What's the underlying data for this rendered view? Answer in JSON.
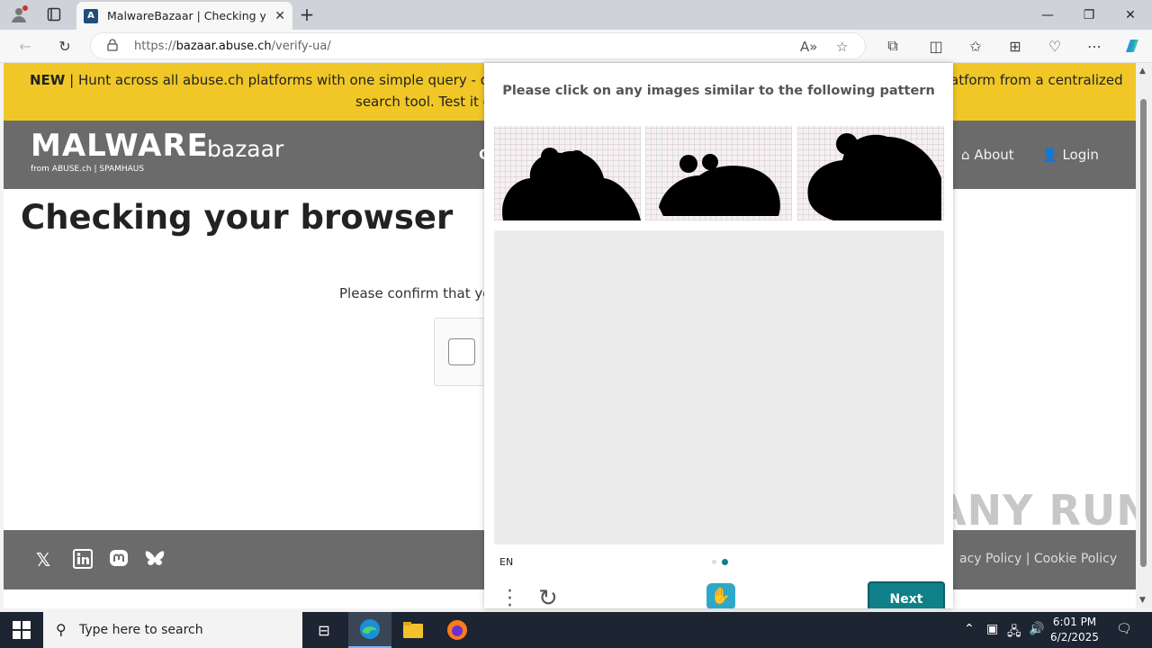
{
  "browser": {
    "tab_title": "MalwareBazaar | Checking your b",
    "tab_favicon_letter": "A",
    "url_prefix": "https://",
    "url_host": "bazaar.abuse.ch",
    "url_path": "/verify-ua/",
    "window_controls": [
      "minimize",
      "restore",
      "close"
    ]
  },
  "site": {
    "banner_new": "NEW",
    "banner_text": " | Hunt across all abuse.ch platforms with one simple query - discove",
    "banner_text_right": "atform from a centralized",
    "banner_text_line2": "search tool. Test it ou",
    "logo_main": "MALWARE",
    "logo_sub": "bazaar",
    "logo_from": "from ABUSE.ch | SPAMHAUS",
    "nav_about": "About",
    "nav_login": "Login",
    "nav_partial": "C",
    "heading": "Checking your browser",
    "confirm_text": "Please confirm that you",
    "footer_links": "acy Policy  |  Cookie Policy",
    "footer_social": [
      "x-icon",
      "linkedin-icon",
      "mastodon-icon",
      "bluesky-icon"
    ],
    "watermark": "ANY RUN"
  },
  "captcha": {
    "title": "Please click on any images similar to the following pattern",
    "language": "EN",
    "next_label": "Next",
    "page_indicator": {
      "pages": 2,
      "active": 2
    },
    "sample_images": [
      "frog-silhouette-1",
      "frog-silhouette-2",
      "frog-silhouette-3"
    ]
  },
  "taskbar": {
    "search_placeholder": "Type here to search",
    "time": "6:01 PM",
    "date": "6/2/2025"
  }
}
